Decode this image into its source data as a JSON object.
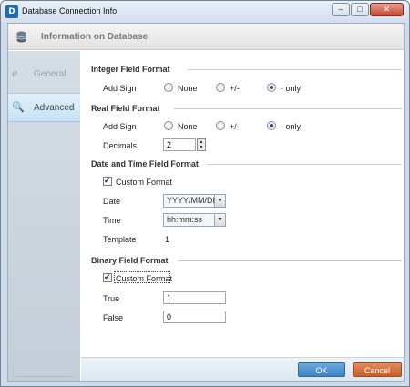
{
  "window": {
    "title": "Database Connection Info",
    "app_icon_letter": "D",
    "minimize_icon": "minimize-icon",
    "maximize_icon": "maximize-icon",
    "close_icon": "close-icon"
  },
  "header": {
    "title": "Information on Database",
    "icon": "database-icon"
  },
  "sidebar": {
    "items": [
      {
        "label": "General",
        "icon": "general-icon",
        "selected": false
      },
      {
        "label": "Advanced",
        "icon": "advanced-icon",
        "selected": true
      }
    ]
  },
  "integer_format": {
    "section_title": "Integer Field Format",
    "add_sign_label": "Add Sign",
    "options": [
      "None",
      "+/-",
      "- only"
    ],
    "selected": "- only"
  },
  "real_format": {
    "section_title": "Real Field Format",
    "add_sign_label": "Add Sign",
    "options": [
      "None",
      "+/-",
      "- only"
    ],
    "selected": "- only",
    "decimals_label": "Decimals",
    "decimals_value": "2"
  },
  "datetime_format": {
    "section_title": "Date and Time Field Format",
    "custom_format_label": "Custom Format",
    "custom_format_checked": true,
    "date_label": "Date",
    "date_value": "YYYY/MM/DD",
    "time_label": "Time",
    "time_value": "hh:mm:ss",
    "template_label": "Template",
    "template_value": "1"
  },
  "binary_format": {
    "section_title": "Binary Field Format",
    "custom_format_label": "Custom Format",
    "custom_format_checked": true,
    "true_label": "True",
    "true_value": "1",
    "false_label": "False",
    "false_value": "0"
  },
  "buttons": {
    "ok": "OK",
    "cancel": "Cancel"
  },
  "colors": {
    "ok_button": "#3c82c4",
    "cancel_button": "#c4602b",
    "sidebar_selected": "#c6e1f5"
  }
}
